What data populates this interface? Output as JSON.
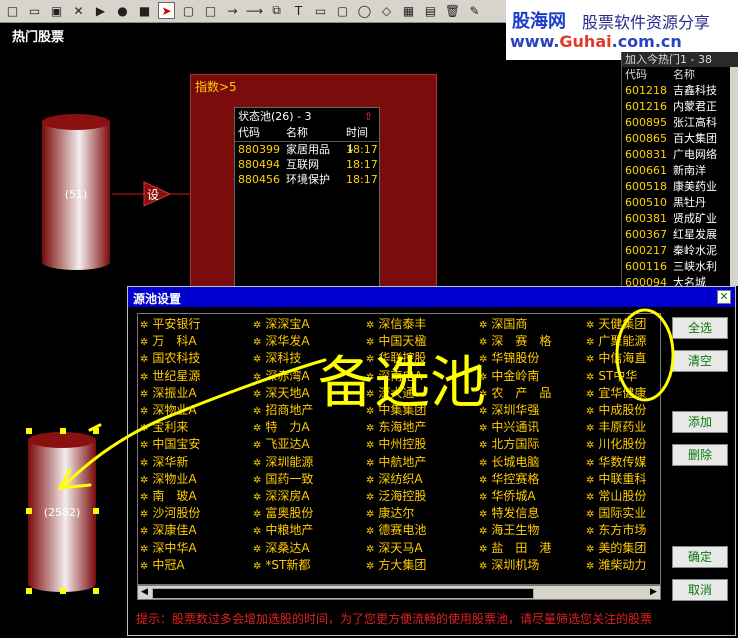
{
  "canvas": {
    "title": "热门股票"
  },
  "toolbar": {
    "icons": [
      "new-icon",
      "open-icon",
      "save-icon",
      "delete-icon",
      "play-icon",
      "record-icon",
      "stop-icon",
      "pointer-icon",
      "rounded-rect-icon",
      "rect-icon",
      "arrow-right-icon",
      "arrow-long-icon",
      "copy-icon",
      "text-icon",
      "rect2-icon",
      "round-rect2-icon",
      "ellipse-icon",
      "diamond-icon",
      "image-icon",
      "chart-icon",
      "trash-icon",
      "brush-icon"
    ]
  },
  "logo": {
    "name": "股海网",
    "tagline": "股票软件资源分享",
    "url_prefix": "www.",
    "url_brand": "Guhai",
    "url_suffix": ".com.cn"
  },
  "cylinders": [
    {
      "label": "(51)"
    },
    {
      "label": "(2582)"
    }
  ],
  "connector": {
    "label": "设"
  },
  "index_panel": {
    "title": "指数>5"
  },
  "status_pool": {
    "title": "状态池(26) - 3",
    "arrow": "⇧",
    "columns": [
      "代码",
      "名称",
      "时间↓"
    ],
    "rows": [
      {
        "code": "880399",
        "name": "家居用品",
        "time": "18:17"
      },
      {
        "code": "880494",
        "name": "互联网",
        "time": "18:17"
      },
      {
        "code": "880456",
        "name": "环境保护",
        "time": "18:17"
      }
    ]
  },
  "hot_list": {
    "title": "加入今热门1 - 38",
    "columns": [
      "代码",
      "名称"
    ],
    "rows": [
      {
        "code": "601218",
        "name": "吉鑫科技"
      },
      {
        "code": "601216",
        "name": "内蒙君正"
      },
      {
        "code": "600895",
        "name": "张江高科"
      },
      {
        "code": "600865",
        "name": "百大集团"
      },
      {
        "code": "600831",
        "name": "广电网络"
      },
      {
        "code": "600661",
        "name": "新南洋"
      },
      {
        "code": "600518",
        "name": "康美药业"
      },
      {
        "code": "600510",
        "name": "黑牡丹"
      },
      {
        "code": "600381",
        "name": "贤成矿业"
      },
      {
        "code": "600367",
        "name": "红星发展"
      },
      {
        "code": "600217",
        "name": "秦岭水泥"
      },
      {
        "code": "600116",
        "name": "三峡水利"
      },
      {
        "code": "600094",
        "name": "大名城"
      }
    ]
  },
  "dialog": {
    "title": "源池设置",
    "close": "✕",
    "columns": [
      [
        "平安银行",
        "万　科A",
        "国农科技",
        "世纪星源",
        "深振业A",
        "深物业A",
        "宝利来",
        "中国宝安",
        "深华新",
        "深物业A",
        "南　玻A",
        "沙河股份",
        "深康佳A",
        "深中华A",
        "中冠A"
      ],
      [
        "深深宝A",
        "深华发A",
        "深科技",
        "深赤湾A",
        "深天地A",
        "招商地产",
        "特　力A",
        "飞亚达A",
        "深圳能源",
        "国药一致",
        "深深房A",
        "富奥股份",
        "中粮地产",
        "深桑达A",
        "*ST新都"
      ],
      [
        "深信泰丰",
        "中国天楹",
        "华联控股",
        "深南电A",
        "深大通",
        "中集集团",
        "东海地产",
        "中州控股",
        "中航地产",
        "深纺织A",
        "泛海控股",
        "康达尔",
        "德赛电池",
        "深天马A",
        "方大集团"
      ],
      [
        "深国商",
        "深　赛　格",
        "华锦股份",
        "中金岭南",
        "农　产　品",
        "深圳华强",
        "中兴通讯",
        "北方国际",
        "长城电脑",
        "华控赛格",
        "华侨城A",
        "特发信息",
        "海王生物",
        "盐　田　港",
        "深圳机场"
      ],
      [
        "天健集团",
        "广聚能源",
        "中信海直",
        "ST中华",
        "宜华健康",
        "中成股份",
        "丰原药业",
        "川化股份",
        "华数传媒",
        "中联重科",
        "常山股份",
        "国际实业",
        "东方市场",
        "美的集团",
        "潍柴动力"
      ]
    ],
    "buttons": {
      "select_all": "全选",
      "clear": "清空",
      "add": "添加",
      "delete": "删除",
      "ok": "确定",
      "cancel": "取消"
    },
    "hint": "提示：股票数过多会增加选股的时间，为了您更方便流畅的使用股票池，请尽量筛选您关注的股票",
    "scroll_left": "◀",
    "scroll_right": "▶"
  },
  "annotation": {
    "text": "备选池",
    "color": "#ffff00"
  }
}
